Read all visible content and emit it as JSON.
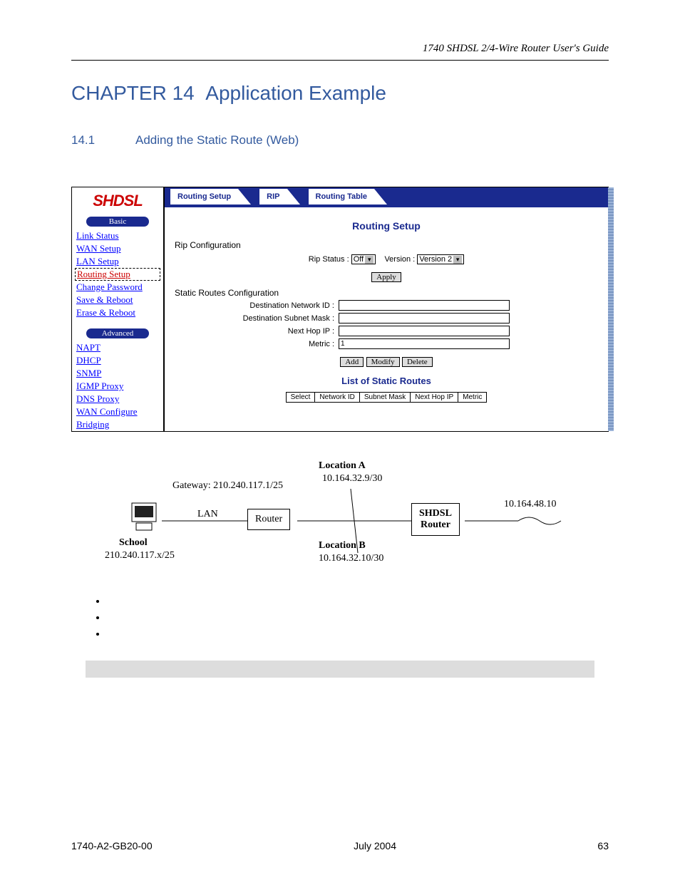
{
  "doc_header": "1740 SHDSL 2/4-Wire Router User's Guide",
  "chapter": {
    "prefix": "CHAPTER 14",
    "title": "Application Example"
  },
  "section": {
    "num": "14.1",
    "title": "Adding the Static Route (Web)"
  },
  "sidebar": {
    "logo": "SHDSL",
    "groups": [
      {
        "label": "Basic",
        "items": [
          {
            "label": "Link Status",
            "active": false
          },
          {
            "label": "WAN Setup",
            "active": false
          },
          {
            "label": "LAN Setup",
            "active": false
          },
          {
            "label": "Routing Setup",
            "active": true
          },
          {
            "label": "Change Password",
            "active": false
          },
          {
            "label": "Save & Reboot",
            "active": false
          },
          {
            "label": "Erase & Reboot",
            "active": false
          }
        ]
      },
      {
        "label": "Advanced",
        "items": [
          {
            "label": "NAPT",
            "active": false
          },
          {
            "label": "DHCP",
            "active": false
          },
          {
            "label": "SNMP",
            "active": false
          },
          {
            "label": "IGMP Proxy",
            "active": false
          },
          {
            "label": "DNS Proxy",
            "active": false
          },
          {
            "label": "WAN Configure",
            "active": false
          },
          {
            "label": "Bridging",
            "active": false
          }
        ]
      }
    ]
  },
  "tabs": [
    {
      "label": "Routing Setup",
      "active": true
    },
    {
      "label": "RIP",
      "active": false
    },
    {
      "label": "Routing Table",
      "active": false
    }
  ],
  "routing_setup": {
    "title": "Routing Setup",
    "rip_section": "Rip Configuration",
    "rip_status_label": "Rip Status :",
    "rip_status_value": "Off",
    "version_label": "Version :",
    "version_value": "Version 2",
    "apply": "Apply",
    "static_section": "Static Routes Configuration",
    "fields": {
      "dest_net": "Destination Network ID :",
      "dest_mask": "Destination Subnet Mask :",
      "next_hop": "Next Hop IP :",
      "metric": "Metric :",
      "metric_value": "1"
    },
    "buttons": {
      "add": "Add",
      "modify": "Modify",
      "delete": "Delete"
    },
    "list_title": "List of Static Routes",
    "table_headers": [
      "Select",
      "Network ID",
      "Subnet Mask",
      "Next Hop IP",
      "Metric"
    ]
  },
  "diagram": {
    "loc_a": "Location A",
    "loc_a_ip": "10.164.32.9/30",
    "loc_b": "Location B",
    "loc_b_ip": "10.164.32.10/30",
    "gateway": "Gateway: 210.240.117.1/25",
    "lan": "LAN",
    "router": "Router",
    "shdsl": "SHDSL\nRouter",
    "school": "School",
    "school_ip": "210.240.117.x/25",
    "remote_ip": "10.164.48.10"
  },
  "footer": {
    "left": "1740-A2-GB20-00",
    "center": "July 2004",
    "right": "63"
  }
}
